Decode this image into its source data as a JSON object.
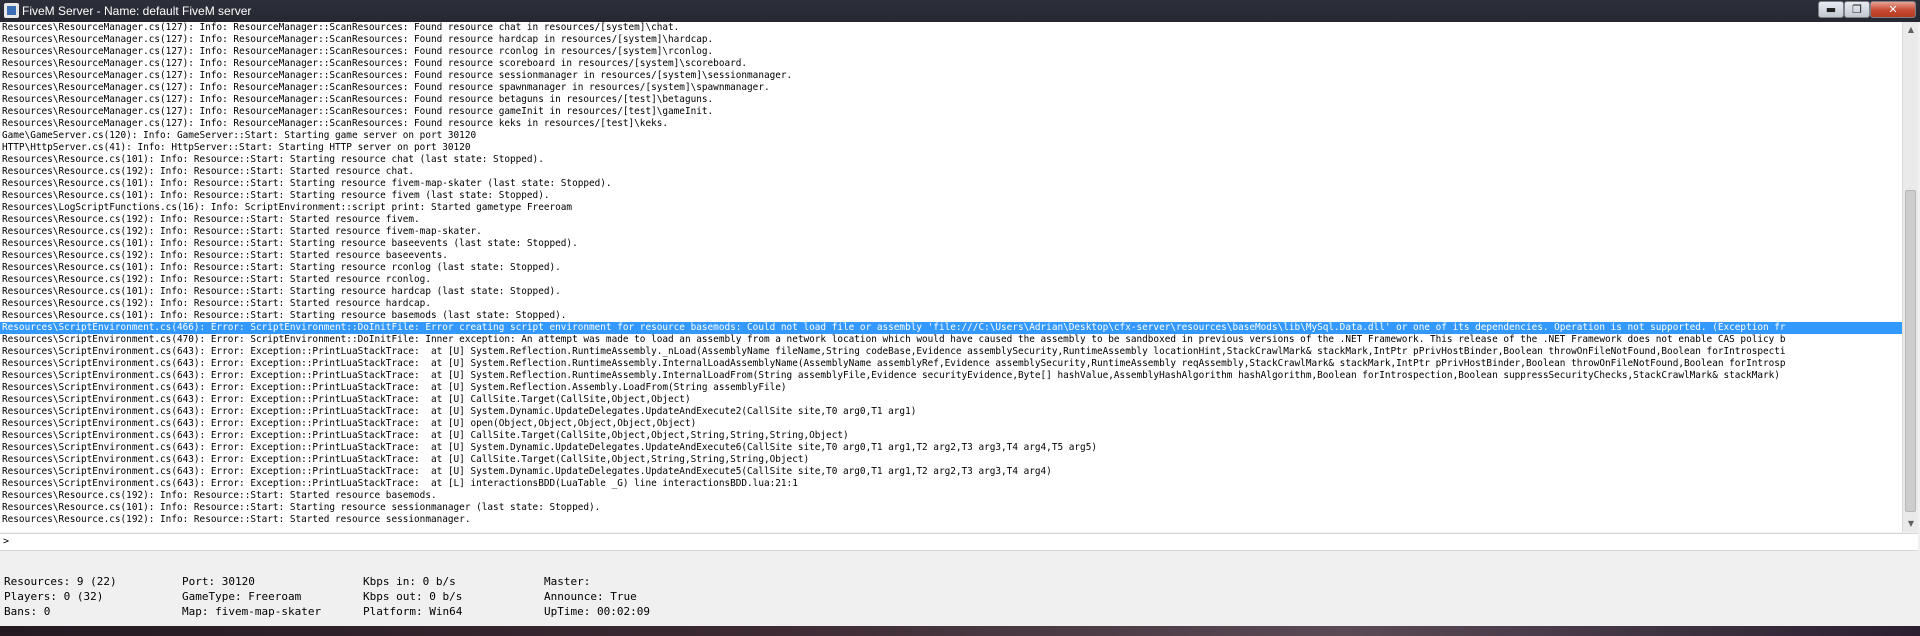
{
  "window": {
    "title": "FiveM Server - Name: default FiveM server",
    "minimize": "▬",
    "maximize": "❐",
    "close": "✕"
  },
  "console": {
    "lines": [
      "Resources\\ResourceManager.cs(127): Info: ResourceManager::ScanResources: Found resource chat in resources/[system]\\chat.",
      "Resources\\ResourceManager.cs(127): Info: ResourceManager::ScanResources: Found resource hardcap in resources/[system]\\hardcap.",
      "Resources\\ResourceManager.cs(127): Info: ResourceManager::ScanResources: Found resource rconlog in resources/[system]\\rconlog.",
      "Resources\\ResourceManager.cs(127): Info: ResourceManager::ScanResources: Found resource scoreboard in resources/[system]\\scoreboard.",
      "Resources\\ResourceManager.cs(127): Info: ResourceManager::ScanResources: Found resource sessionmanager in resources/[system]\\sessionmanager.",
      "Resources\\ResourceManager.cs(127): Info: ResourceManager::ScanResources: Found resource spawnmanager in resources/[system]\\spawnmanager.",
      "Resources\\ResourceManager.cs(127): Info: ResourceManager::ScanResources: Found resource betaguns in resources/[test]\\betaguns.",
      "Resources\\ResourceManager.cs(127): Info: ResourceManager::ScanResources: Found resource gameInit in resources/[test]\\gameInit.",
      "Resources\\ResourceManager.cs(127): Info: ResourceManager::ScanResources: Found resource keks in resources/[test]\\keks.",
      "Game\\GameServer.cs(120): Info: GameServer::Start: Starting game server on port 30120",
      "HTTP\\HttpServer.cs(41): Info: HttpServer::Start: Starting HTTP server on port 30120",
      "Resources\\Resource.cs(101): Info: Resource::Start: Starting resource chat (last state: Stopped).",
      "Resources\\Resource.cs(192): Info: Resource::Start: Started resource chat.",
      "Resources\\Resource.cs(101): Info: Resource::Start: Starting resource fivem-map-skater (last state: Stopped).",
      "Resources\\Resource.cs(101): Info: Resource::Start: Starting resource fivem (last state: Stopped).",
      "Resources\\LogScriptFunctions.cs(16): Info: ScriptEnvironment::script print: Started gametype Freeroam",
      "Resources\\Resource.cs(192): Info: Resource::Start: Started resource fivem.",
      "Resources\\Resource.cs(192): Info: Resource::Start: Started resource fivem-map-skater.",
      "Resources\\Resource.cs(101): Info: Resource::Start: Starting resource baseevents (last state: Stopped).",
      "Resources\\Resource.cs(192): Info: Resource::Start: Started resource baseevents.",
      "Resources\\Resource.cs(101): Info: Resource::Start: Starting resource rconlog (last state: Stopped).",
      "Resources\\Resource.cs(192): Info: Resource::Start: Started resource rconlog.",
      "Resources\\Resource.cs(101): Info: Resource::Start: Starting resource hardcap (last state: Stopped).",
      "Resources\\Resource.cs(192): Info: Resource::Start: Started resource hardcap.",
      "Resources\\Resource.cs(101): Info: Resource::Start: Starting resource basemods (last state: Stopped).",
      "Resources\\ScriptEnvironment.cs(466): Error: ScriptEnvironment::DoInitFile: Error creating script environment for resource basemods: Could not load file or assembly 'file:///C:\\Users\\Adrian\\Desktop\\cfx-server\\resources\\baseMods\\lib\\MySql.Data.dll' or one of its dependencies. Operation is not supported. (Exception fr",
      "Resources\\ScriptEnvironment.cs(470): Error: ScriptEnvironment::DoInitFile: Inner exception: An attempt was made to load an assembly from a network location which would have caused the assembly to be sandboxed in previous versions of the .NET Framework. This release of the .NET Framework does not enable CAS policy b",
      "Resources\\ScriptEnvironment.cs(643): Error: Exception::PrintLuaStackTrace:  at [U] System.Reflection.RuntimeAssembly._nLoad(AssemblyName fileName,String codeBase,Evidence assemblySecurity,RuntimeAssembly locationHint,StackCrawlMark& stackMark,IntPtr pPrivHostBinder,Boolean throwOnFileNotFound,Boolean forIntrospecti",
      "Resources\\ScriptEnvironment.cs(643): Error: Exception::PrintLuaStackTrace:  at [U] System.Reflection.RuntimeAssembly.InternalLoadAssemblyName(AssemblyName assemblyRef,Evidence assemblySecurity,RuntimeAssembly reqAssembly,StackCrawlMark& stackMark,IntPtr pPrivHostBinder,Boolean throwOnFileNotFound,Boolean forIntrosp",
      "Resources\\ScriptEnvironment.cs(643): Error: Exception::PrintLuaStackTrace:  at [U] System.Reflection.RuntimeAssembly.InternalLoadFrom(String assemblyFile,Evidence securityEvidence,Byte[] hashValue,AssemblyHashAlgorithm hashAlgorithm,Boolean forIntrospection,Boolean suppressSecurityChecks,StackCrawlMark& stackMark)",
      "Resources\\ScriptEnvironment.cs(643): Error: Exception::PrintLuaStackTrace:  at [U] System.Reflection.Assembly.LoadFrom(String assemblyFile)",
      "Resources\\ScriptEnvironment.cs(643): Error: Exception::PrintLuaStackTrace:  at [U] CallSite.Target(CallSite,Object,Object)",
      "Resources\\ScriptEnvironment.cs(643): Error: Exception::PrintLuaStackTrace:  at [U] System.Dynamic.UpdateDelegates.UpdateAndExecute2(CallSite site,T0 arg0,T1 arg1)",
      "Resources\\ScriptEnvironment.cs(643): Error: Exception::PrintLuaStackTrace:  at [U] open(Object,Object,Object,Object,Object)",
      "Resources\\ScriptEnvironment.cs(643): Error: Exception::PrintLuaStackTrace:  at [U] CallSite.Target(CallSite,Object,Object,String,String,String,Object)",
      "Resources\\ScriptEnvironment.cs(643): Error: Exception::PrintLuaStackTrace:  at [U] System.Dynamic.UpdateDelegates.UpdateAndExecute6(CallSite site,T0 arg0,T1 arg1,T2 arg2,T3 arg3,T4 arg4,T5 arg5)",
      "Resources\\ScriptEnvironment.cs(643): Error: Exception::PrintLuaStackTrace:  at [U] CallSite.Target(CallSite,Object,String,String,String,Object)",
      "Resources\\ScriptEnvironment.cs(643): Error: Exception::PrintLuaStackTrace:  at [U] System.Dynamic.UpdateDelegates.UpdateAndExecute5(CallSite site,T0 arg0,T1 arg1,T2 arg2,T3 arg3,T4 arg4)",
      "Resources\\ScriptEnvironment.cs(643): Error: Exception::PrintLuaStackTrace:  at [L] interactionsBDD(LuaTable _G) line interactionsBDD.lua:21:1",
      "Resources\\Resource.cs(192): Info: Resource::Start: Started resource basemods.",
      "Resources\\Resource.cs(101): Info: Resource::Start: Starting resource sessionmanager (last state: Stopped).",
      "Resources\\Resource.cs(192): Info: Resource::Start: Started resource sessionmanager."
    ],
    "highlighted_index": 25
  },
  "command": {
    "prompt": ">",
    "value": ""
  },
  "status": {
    "col1": [
      "Resources: 9 (22)",
      "Players: 0 (32)",
      "Bans: 0"
    ],
    "col2": [
      "Port: 30120",
      "GameType: Freeroam",
      "Map: fivem-map-skater"
    ],
    "col3": [
      "Kbps in: 0 b/s",
      "Kbps out: 0 b/s",
      "Platform: Win64"
    ],
    "col4": [
      "Master:",
      "Announce: True",
      "UpTime: 00:02:09"
    ]
  },
  "scrollbar": {
    "up_arrow": "▲",
    "down_arrow": "▼"
  }
}
